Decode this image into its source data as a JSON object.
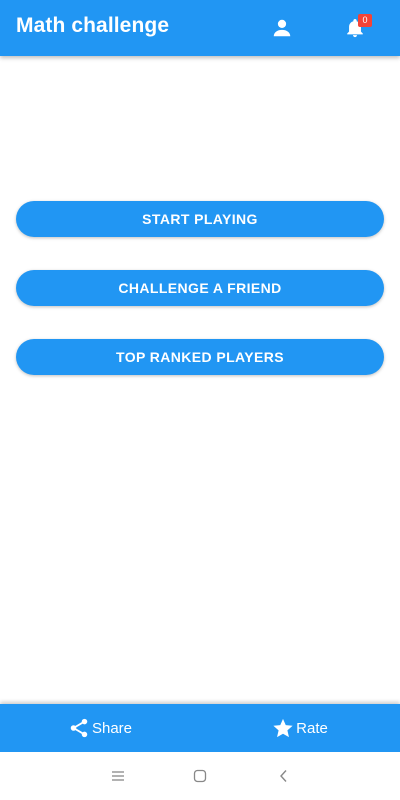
{
  "app_bar": {
    "title": "Math challenge",
    "notification_count": "0",
    "icons": [
      "person-icon",
      "bell-icon"
    ]
  },
  "menu": {
    "start_playing": "START PLAYING",
    "challenge_friend": "CHALLENGE A FRIEND",
    "top_ranked": "TOP RANKED PLAYERS"
  },
  "bottom_bar": {
    "share_label": "Share",
    "rate_label": "Rate",
    "icons": [
      "share-icon",
      "star-icon"
    ]
  },
  "system_nav": {
    "icons": [
      "menu-lines-icon",
      "home-square-icon",
      "back-chevron-icon"
    ]
  },
  "colors": {
    "primary": "#2196f3",
    "badge": "#f44336",
    "on_primary": "#ffffff",
    "background": "#ffffff"
  }
}
